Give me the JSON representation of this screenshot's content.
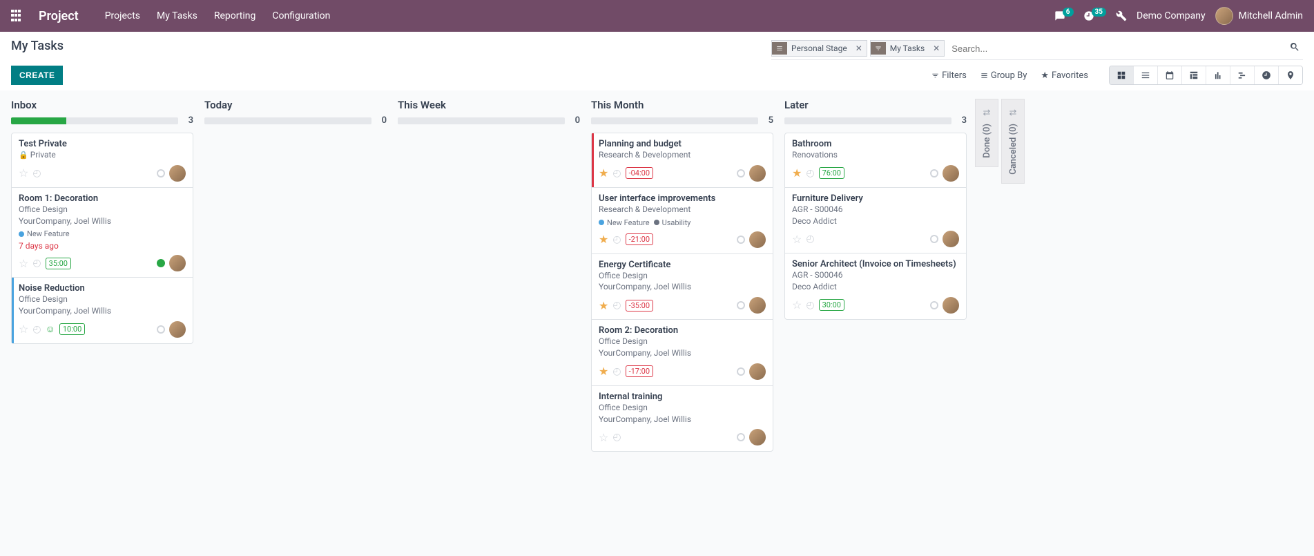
{
  "brand": "Project",
  "nav": {
    "projects": "Projects",
    "mytasks": "My Tasks",
    "reporting": "Reporting",
    "config": "Configuration"
  },
  "badges": {
    "messages": "6",
    "activities": "35"
  },
  "company": "Demo Company",
  "user": "Mitchell Admin",
  "page_title": "My Tasks",
  "facets": {
    "group": {
      "label": "Personal Stage"
    },
    "filter": {
      "label": "My Tasks"
    }
  },
  "search_placeholder": "Search...",
  "create_btn": "CREATE",
  "tools": {
    "filters": "Filters",
    "groupby": "Group By",
    "favorites": "Favorites"
  },
  "columns": [
    {
      "title": "Inbox",
      "count": "3",
      "progress": 33
    },
    {
      "title": "Today",
      "count": "0",
      "progress": 0
    },
    {
      "title": "This Week",
      "count": "0",
      "progress": 0
    },
    {
      "title": "This Month",
      "count": "5",
      "progress": 0
    },
    {
      "title": "Later",
      "count": "3",
      "progress": 0
    }
  ],
  "inbox": [
    {
      "title": "Test Private",
      "is_private": true,
      "private_label": "Private",
      "starred": false,
      "hours": null
    },
    {
      "title": "Room 1: Decoration",
      "project": "Office Design",
      "partner": "YourCompany, Joel Willis",
      "tags": [
        {
          "label": "New Feature",
          "color": "#4aa3df"
        }
      ],
      "due": "7 days ago",
      "hours": "35:00",
      "hours_neg": false,
      "state_green": true,
      "starred": false
    },
    {
      "title": "Noise Reduction",
      "project": "Office Design",
      "partner": "YourCompany, Joel Willis",
      "hours": "10:00",
      "hours_neg": false,
      "smile": true,
      "starred": false,
      "bar": "blue"
    }
  ],
  "thismonth": [
    {
      "title": "Planning and budget",
      "project": "Research & Development",
      "hours": "-04:00",
      "hours_neg": true,
      "starred": true,
      "bar": "red"
    },
    {
      "title": "User interface improvements",
      "project": "Research & Development",
      "tags": [
        {
          "label": "New Feature",
          "color": "#4aa3df"
        },
        {
          "label": "Usability",
          "color": "#6b7280"
        }
      ],
      "hours": "-21:00",
      "hours_neg": true,
      "starred": true
    },
    {
      "title": "Energy Certificate",
      "project": "Office Design",
      "partner": "YourCompany, Joel Willis",
      "hours": "-35:00",
      "hours_neg": true,
      "starred": true
    },
    {
      "title": "Room 2: Decoration",
      "project": "Office Design",
      "partner": "YourCompany, Joel Willis",
      "hours": "-17:00",
      "hours_neg": true,
      "starred": true
    },
    {
      "title": "Internal training",
      "project": "Office Design",
      "partner": "YourCompany, Joel Willis",
      "hours": null,
      "starred": false
    }
  ],
  "later": [
    {
      "title": "Bathroom",
      "project": "Renovations",
      "hours": "76:00",
      "hours_neg": false,
      "starred": true
    },
    {
      "title": "Furniture Delivery",
      "project": "AGR - S00046",
      "partner": "Deco Addict",
      "hours": null,
      "starred": false
    },
    {
      "title": "Senior Architect (Invoice on Timesheets)",
      "project": "AGR - S00046",
      "partner": "Deco Addict",
      "hours": "30:00",
      "hours_neg": false,
      "starred": false
    }
  ],
  "folded": [
    {
      "label": "Done (0)"
    },
    {
      "label": "Canceled (0)"
    }
  ]
}
